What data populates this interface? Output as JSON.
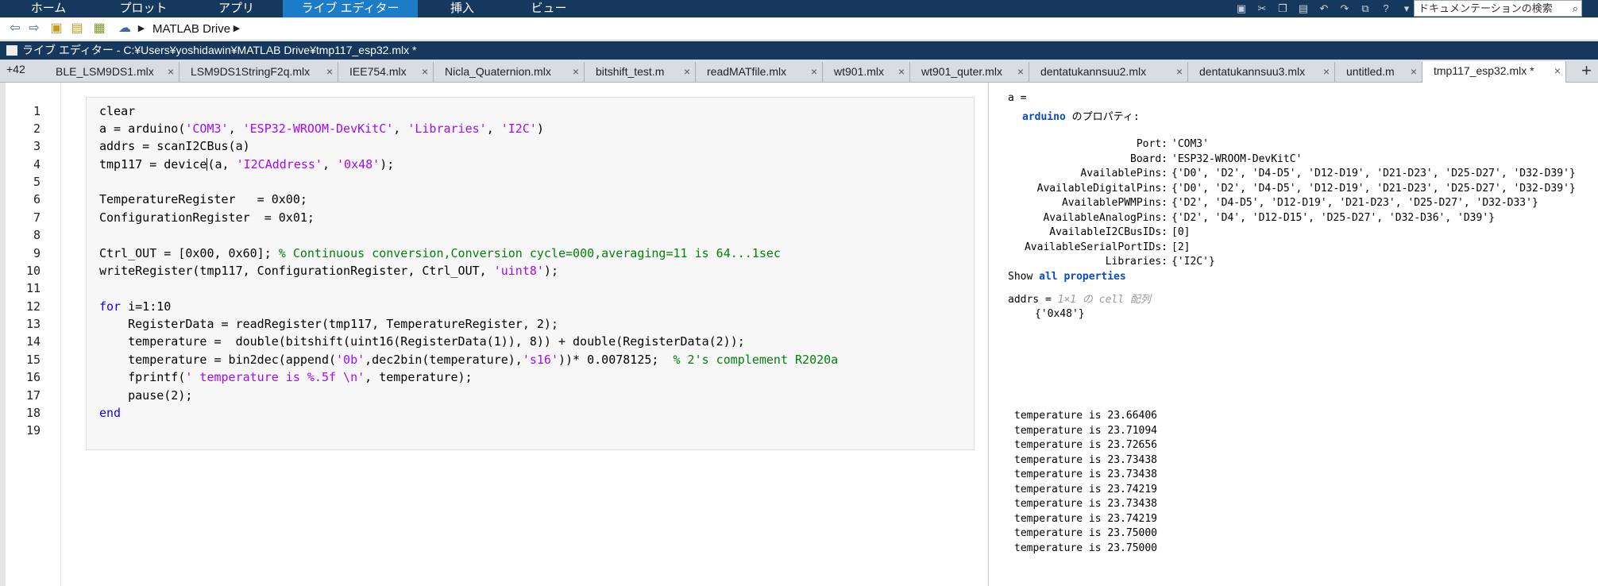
{
  "ribbon": {
    "tabs": [
      "ホーム",
      "プロット",
      "アプリ",
      "ライブ エディター",
      "挿入",
      "ビュー"
    ],
    "active_tab": "ライブ エディター",
    "search_placeholder": "ドキュメンテーションの検索"
  },
  "address_bar": {
    "path_label": "MATLAB Drive"
  },
  "editor_title": "ライブ エディター - C:¥Users¥yoshidawin¥MATLAB Drive¥tmp117_esp32.mlx *",
  "doc_tabs": {
    "overflow_count": "+42",
    "tabs": [
      "BLE_LSM9DS1.mlx",
      "LSM9DS1StringF2q.mlx",
      "IEE754.mlx",
      "Nicla_Quaternion.mlx",
      "bitshift_test.m",
      "readMATfile.mlx",
      "wt901.mlx",
      "wt901_quter.mlx",
      "dentatukannsuu2.mlx",
      "dentatukannsuu3.mlx",
      "untitled.m",
      "tmp117_esp32.mlx *"
    ],
    "active_index": 11
  },
  "code": {
    "line_numbers": [
      "1",
      "2",
      "3",
      "4",
      "5",
      "6",
      "7",
      "8",
      "9",
      "10",
      "11",
      "12",
      "13",
      "14",
      "15",
      "16",
      "17",
      "18",
      "19"
    ],
    "l1": "clear",
    "l2a": "a = arduino(",
    "l2s1": "'COM3'",
    "l2b": ", ",
    "l2s2": "'ESP32-WROOM-DevKitC'",
    "l2c": ", ",
    "l2s3": "'Libraries'",
    "l2d": ", ",
    "l2s4": "'I2C'",
    "l2e": ")",
    "l3": "addrs = scanI2CBus(a)",
    "l4a": "tmp117 = device",
    "l4b": "(a, ",
    "l4s1": "'I2CAddress'",
    "l4c": ", ",
    "l4s2": "'0x48'",
    "l4d": ");",
    "l6": "TemperatureRegister   = 0x00;",
    "l7": "ConfigurationRegister  = 0x01;",
    "l9a": "Ctrl_OUT = [0x00, 0x60]; ",
    "l9c": "% Continuous conversion,Conversion cycle=000,averaging=11 is 64...1sec",
    "l10a": "writeRegister(tmp117, ConfigurationRegister, Ctrl_OUT, ",
    "l10s": "'uint8'",
    "l10b": ");",
    "l12k": "for",
    "l12a": " i=1:10",
    "l13": "    RegisterData = readRegister(tmp117, TemperatureRegister, 2);",
    "l14": "    temperature =  double(bitshift(uint16(RegisterData(1)), 8)) + double(RegisterData(2));",
    "l15a": "    temperature = bin2dec(append(",
    "l15s1": "'0b'",
    "l15b": ",dec2bin(temperature),",
    "l15s2": "'s16'",
    "l15c": "))* 0.0078125;  ",
    "l15cm": "% 2's complement R2020a",
    "l16a": "    fprintf(",
    "l16s": "' temperature is %.5f \\n'",
    "l16b": ", temperature);",
    "l17": "    pause(2);",
    "l18k": "end"
  },
  "output": {
    "a_eq": "a =",
    "arduino_word": "arduino",
    "props_suffix": " のプロパティ:",
    "props": [
      {
        "name": "Port:",
        "value": "'COM3'"
      },
      {
        "name": "Board:",
        "value": "'ESP32-WROOM-DevKitC'"
      },
      {
        "name": "AvailablePins:",
        "value": "{'D0', 'D2', 'D4-D5', 'D12-D19', 'D21-D23', 'D25-D27', 'D32-D39'}"
      },
      {
        "name": "AvailableDigitalPins:",
        "value": "{'D0', 'D2', 'D4-D5', 'D12-D19', 'D21-D23', 'D25-D27', 'D32-D39'}"
      },
      {
        "name": "AvailablePWMPins:",
        "value": "{'D2', 'D4-D5', 'D12-D19', 'D21-D23', 'D25-D27', 'D32-D33'}"
      },
      {
        "name": "AvailableAnalogPins:",
        "value": "{'D2', 'D4', 'D12-D15', 'D25-D27', 'D32-D36', 'D39'}"
      },
      {
        "name": "AvailableI2CBusIDs:",
        "value": "[0]"
      },
      {
        "name": "AvailableSerialPortIDs:",
        "value": "[2]"
      },
      {
        "name": "Libraries:",
        "value": "{'I2C'}"
      }
    ],
    "show_word": "Show ",
    "all_props_link": "all properties",
    "addrs_eq": "addrs = ",
    "addrs_type": "1×1 の cell 配列",
    "addrs_val": "{'0x48'}",
    "temps": [
      "temperature is 23.66406",
      "temperature is 23.71094",
      "temperature is 23.72656",
      "temperature is 23.73438",
      "temperature is 23.73438",
      "temperature is 23.74219",
      "temperature is 23.73438",
      "temperature is 23.74219",
      "temperature is 23.75000",
      "temperature is 23.75000"
    ]
  }
}
